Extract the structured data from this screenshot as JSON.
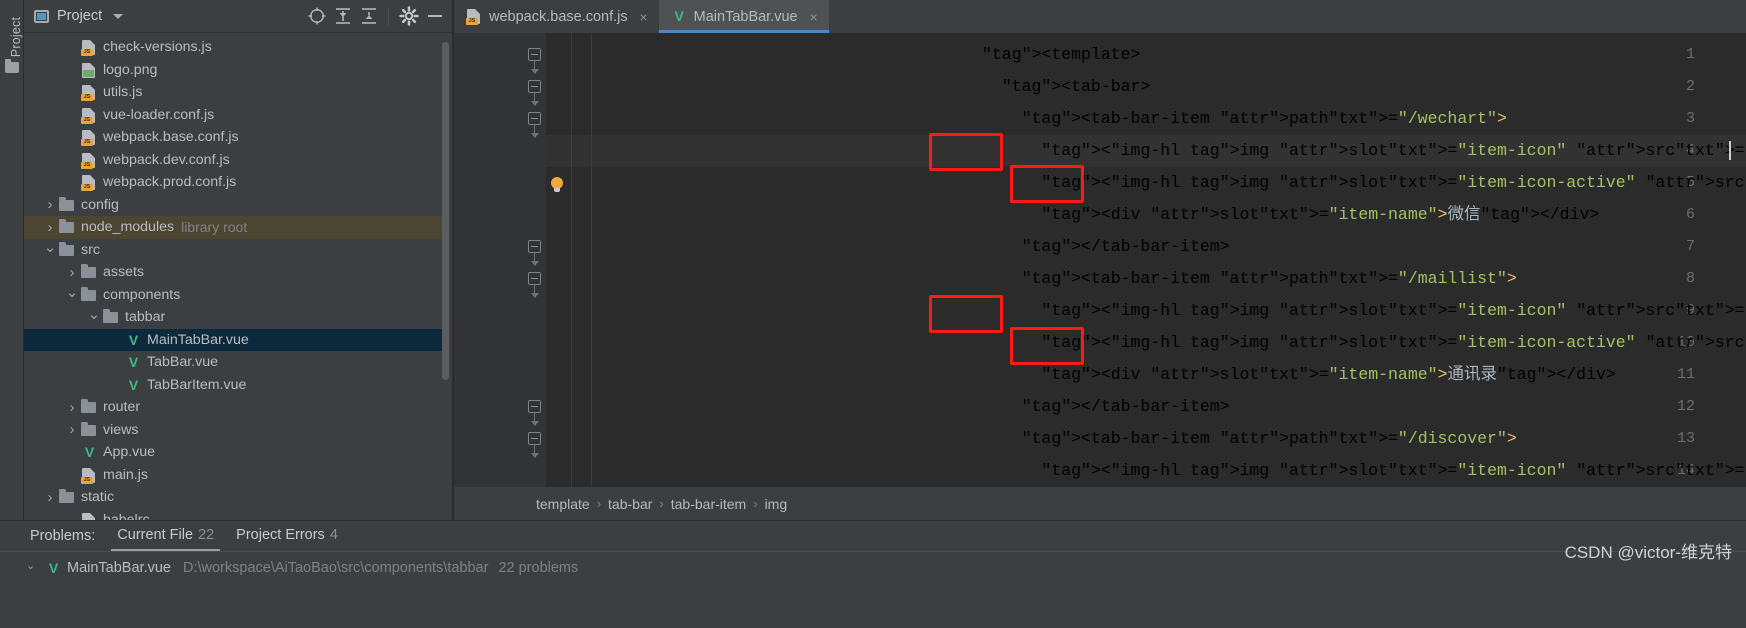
{
  "window": {
    "left_strip_label": "Project"
  },
  "project_panel": {
    "title": "Project",
    "toolbar_icons": [
      "locate-icon",
      "expand-all-icon",
      "collapse-all-icon",
      "settings-icon",
      "hide-icon"
    ],
    "tree": [
      {
        "indent": 2,
        "arrow": "",
        "icon": "js-file-icon",
        "label": "check-versions.js",
        "note": "",
        "state": ""
      },
      {
        "indent": 2,
        "arrow": "",
        "icon": "png-file-icon",
        "label": "logo.png",
        "note": "",
        "state": ""
      },
      {
        "indent": 2,
        "arrow": "",
        "icon": "js-file-icon",
        "label": "utils.js",
        "note": "",
        "state": ""
      },
      {
        "indent": 2,
        "arrow": "",
        "icon": "js-file-icon",
        "label": "vue-loader.conf.js",
        "note": "",
        "state": ""
      },
      {
        "indent": 2,
        "arrow": "",
        "icon": "js-file-icon",
        "label": "webpack.base.conf.js",
        "note": "",
        "state": ""
      },
      {
        "indent": 2,
        "arrow": "",
        "icon": "js-file-icon",
        "label": "webpack.dev.conf.js",
        "note": "",
        "state": ""
      },
      {
        "indent": 2,
        "arrow": "",
        "icon": "js-file-icon",
        "label": "webpack.prod.conf.js",
        "note": "",
        "state": ""
      },
      {
        "indent": 1,
        "arrow": "right",
        "icon": "folder-icon",
        "label": "config",
        "note": "",
        "state": ""
      },
      {
        "indent": 1,
        "arrow": "right",
        "icon": "folder-icon",
        "label": "node_modules",
        "note": "library root",
        "state": "library"
      },
      {
        "indent": 1,
        "arrow": "down",
        "icon": "folder-icon",
        "label": "src",
        "note": "",
        "state": ""
      },
      {
        "indent": 2,
        "arrow": "right",
        "icon": "folder-icon",
        "label": "assets",
        "note": "",
        "state": ""
      },
      {
        "indent": 2,
        "arrow": "down",
        "icon": "folder-icon",
        "label": "components",
        "note": "",
        "state": ""
      },
      {
        "indent": 3,
        "arrow": "down",
        "icon": "folder-icon",
        "label": "tabbar",
        "note": "",
        "state": ""
      },
      {
        "indent": 4,
        "arrow": "",
        "icon": "vue-file-icon",
        "label": "MainTabBar.vue",
        "note": "",
        "state": "selected"
      },
      {
        "indent": 4,
        "arrow": "",
        "icon": "vue-file-icon",
        "label": "TabBar.vue",
        "note": "",
        "state": ""
      },
      {
        "indent": 4,
        "arrow": "",
        "icon": "vue-file-icon",
        "label": "TabBarItem.vue",
        "note": "",
        "state": ""
      },
      {
        "indent": 2,
        "arrow": "right",
        "icon": "folder-icon",
        "label": "router",
        "note": "",
        "state": ""
      },
      {
        "indent": 2,
        "arrow": "right",
        "icon": "folder-icon",
        "label": "views",
        "note": "",
        "state": ""
      },
      {
        "indent": 2,
        "arrow": "",
        "icon": "vue-file-icon",
        "label": "App.vue",
        "note": "",
        "state": ""
      },
      {
        "indent": 2,
        "arrow": "",
        "icon": "js-file-icon",
        "label": "main.js",
        "note": "",
        "state": ""
      },
      {
        "indent": 1,
        "arrow": "right",
        "icon": "folder-icon",
        "label": "static",
        "note": "",
        "state": ""
      },
      {
        "indent": 2,
        "arrow": "",
        "icon": "js-file-icon",
        "label": "babelrc",
        "note": "",
        "state": ""
      }
    ]
  },
  "editor": {
    "tabs": [
      {
        "label": "webpack.base.conf.js",
        "icon": "js-file-icon",
        "active": false,
        "close": "×"
      },
      {
        "label": "MainTabBar.vue",
        "icon": "vue-file-icon",
        "active": true,
        "close": "×"
      }
    ],
    "line_numbers": [
      "1",
      "2",
      "3",
      "4",
      "5",
      "6",
      "7",
      "8",
      "9",
      "10",
      "11",
      "12",
      "13",
      "14"
    ],
    "lines": [
      "<template>",
      "  <tab-bar>",
      "    <tab-bar-item path=\"/wechart\">",
      "      <img slot=\"item-icon\" src=\"../../assets/imgs/wechart.svg\">",
      "      <img slot=\"item-icon-active\" src=\"../../assets/imgs/wechart-active.svg\">",
      "      <div slot=\"item-name\">微信</div>",
      "    </tab-bar-item>",
      "    <tab-bar-item path=\"/maillist\">",
      "      <img slot=\"item-icon\" src=\"../../assets/imgs/maillist.svg\">",
      "      <img slot=\"item-icon-active\" src=\"../../assets/imgs/maillist-active.svg\">",
      "      <div slot=\"item-name\">通讯录</div>",
      "    </tab-bar-item>",
      "    <tab-bar-item path=\"/discover\">",
      "      <img slot=\"item-icon\" src=\"../../assets/imgs/discover.svg\">"
    ],
    "breadcrumb": [
      "template",
      "tab-bar",
      "tab-bar-item",
      "img"
    ],
    "breadcrumb_separator": "›",
    "annotations": {
      "highlight_color": "#ff1a1a",
      "boxes": [
        "line4-relative-path",
        "line5-relative-path",
        "line9-relative-path",
        "line10-relative-path"
      ]
    }
  },
  "problems_panel": {
    "label": "Problems:",
    "tabs": [
      {
        "label": "Current File",
        "count": "22",
        "active": true
      },
      {
        "label": "Project Errors",
        "count": "4",
        "active": false
      }
    ],
    "row": {
      "icon": "vue-file-icon",
      "file": "MainTabBar.vue",
      "path": "D:\\workspace\\AiTaoBao\\src\\components\\tabbar",
      "problems": "22 problems"
    }
  },
  "watermark": "CSDN @victor-维克特"
}
